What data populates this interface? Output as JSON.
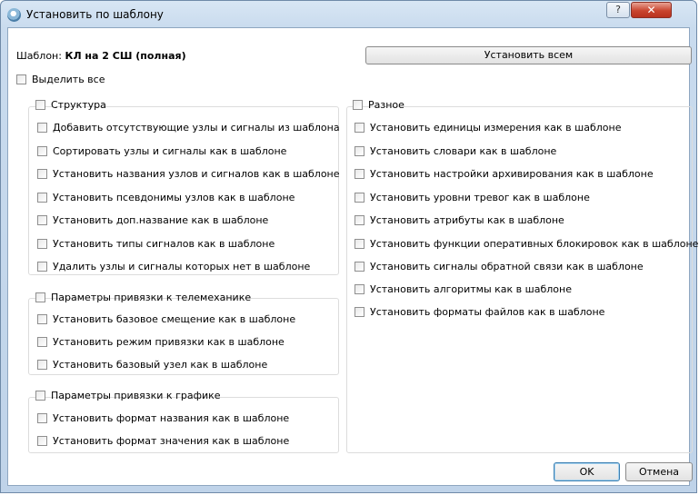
{
  "window": {
    "title": "Установить по шаблону",
    "help_label": "?",
    "close_label": "✕"
  },
  "template": {
    "label": "Шаблон: ",
    "name": "КЛ на 2 СШ (полная)"
  },
  "buttons": {
    "set_all": "Установить всем",
    "ok": "OK",
    "cancel": "Отмена"
  },
  "select_all": "Выделить все",
  "groups": {
    "structure": {
      "title": "Структура",
      "items": [
        "Добавить отсутствующие узлы и сигналы из шаблона",
        "Сортировать узлы и сигналы как в шаблоне",
        "Установить названия узлов и сигналов как в шаблоне",
        "Установить псевдонимы узлов как в шаблоне",
        "Установить доп.название как в шаблоне",
        "Установить типы сигналов как в шаблоне",
        "Удалить узлы и сигналы которых нет в шаблоне"
      ]
    },
    "telemechanics": {
      "title": "Параметры привязки к телемеханике",
      "items": [
        "Установить базовое смещение как в шаблоне",
        "Установить режим привязки как в шаблоне",
        "Установить базовый узел как в шаблоне"
      ]
    },
    "graphics": {
      "title": "Параметры привязки к графике",
      "items": [
        "Установить формат названия как в шаблоне",
        "Установить формат значения как в шаблоне"
      ]
    },
    "misc": {
      "title": "Разное",
      "items": [
        "Установить единицы измерения как в шаблоне",
        "Установить словари как в шаблоне",
        "Установить настройки архивирования как в шаблоне",
        "Установить уровни тревог как в шаблоне",
        "Установить атрибуты как в шаблоне",
        "Установить функции оперативных блокировок как в шаблоне",
        "Установить сигналы обратной связи как в шаблоне",
        "Установить алгоритмы как в шаблоне",
        "Установить форматы файлов как в шаблоне"
      ]
    }
  }
}
